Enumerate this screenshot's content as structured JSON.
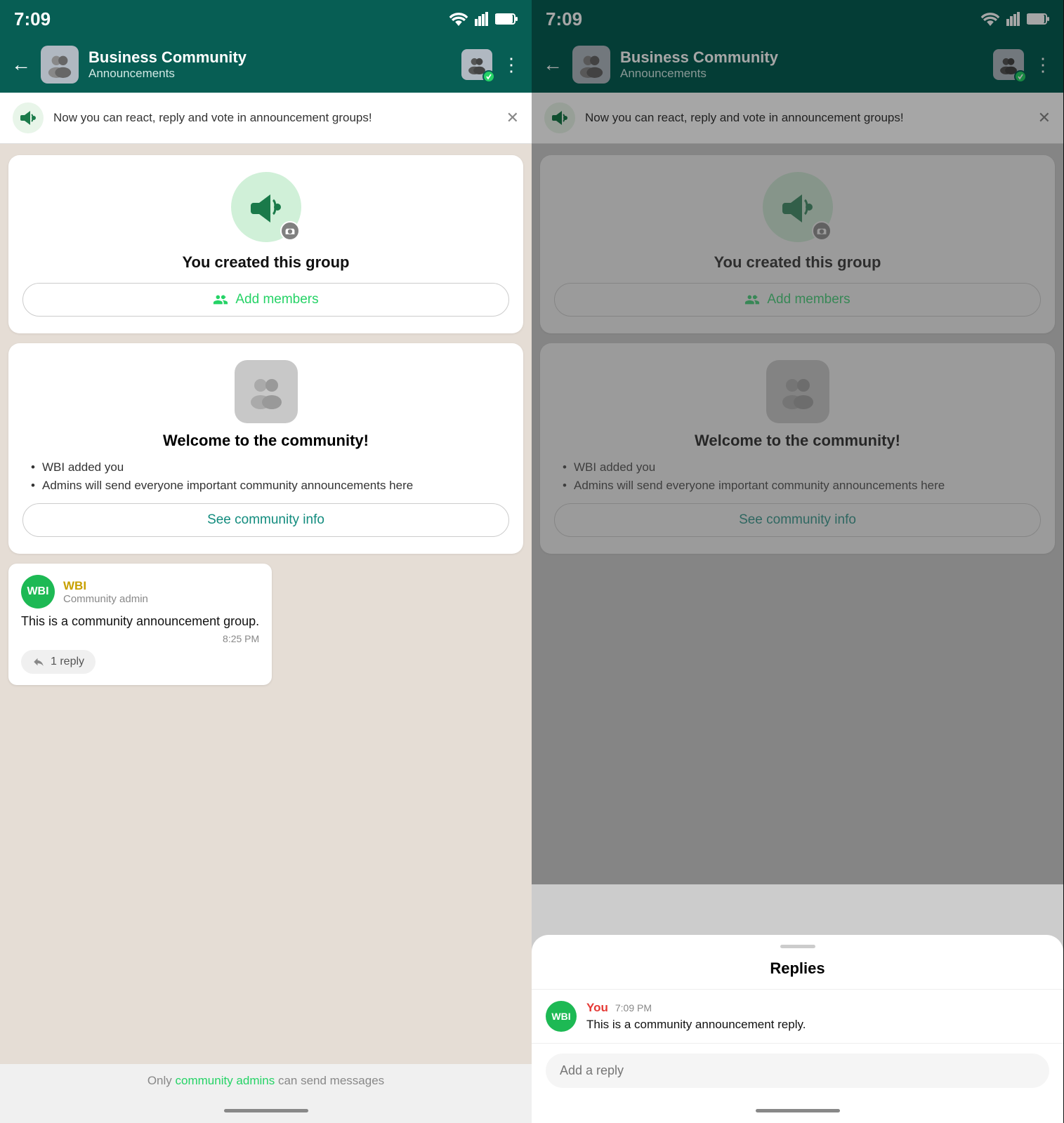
{
  "left": {
    "status_time": "7:09",
    "header": {
      "title": "Business Community",
      "subtitle": "Announcements",
      "back_label": "←",
      "dots": "⋮"
    },
    "banner": {
      "text": "Now you can react, reply and vote in announcement groups!",
      "close": "✕"
    },
    "card1": {
      "title": "You created this group",
      "add_members_label": "Add members"
    },
    "card2": {
      "title": "Welcome to the community!",
      "bullet1": "WBI added you",
      "bullet2": "Admins will send everyone important community announcements here",
      "see_community_label": "See community info"
    },
    "message": {
      "sender": "WBI",
      "role": "Community admin",
      "text": "This is a community announcement group.",
      "time": "8:25 PM",
      "reply_label": "1 reply"
    },
    "footer": {
      "text": "Only ",
      "highlight": "community admins",
      "text2": " can send messages"
    }
  },
  "right": {
    "status_time": "7:09",
    "header": {
      "title": "Business Community",
      "subtitle": "Announcements",
      "back_label": "←",
      "dots": "⋮"
    },
    "banner": {
      "text": "Now you can react, reply and vote in announcement groups!",
      "close": "✕"
    },
    "card1": {
      "title": "You created this group",
      "add_members_label": "Add members"
    },
    "card2": {
      "title": "Welcome to the community!",
      "bullet1": "WBI added you",
      "bullet2": "Admins will send everyone important community announcements here",
      "see_community_label": "See community info"
    },
    "replies_sheet": {
      "handle": "",
      "title": "Replies",
      "reply": {
        "sender": "You",
        "time": "7:09 PM",
        "text": "This is a community announcement reply.",
        "avatar_label": "WBI"
      },
      "input_placeholder": "Add a reply"
    }
  }
}
